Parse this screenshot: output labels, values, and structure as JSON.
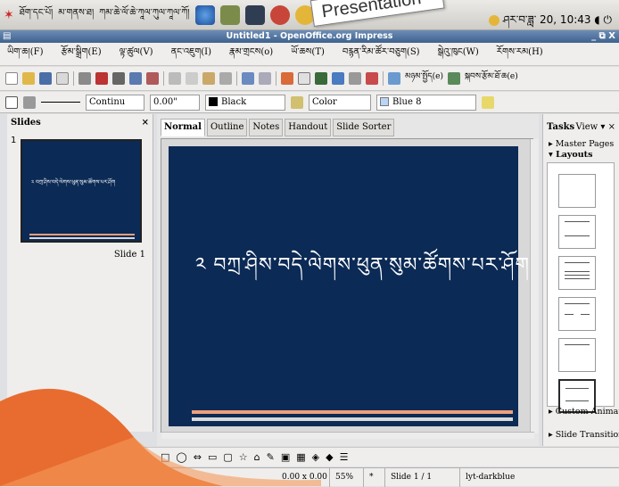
{
  "topbar": {
    "menus": [
      "ཐོག་དང་པོ།",
      "མ་གནས་ཐ།",
      "ཀམ་ཆེ་ལོ་ཆེ་ཀཱལ་ཀུལ་ཀཱལ་ཀོ།",
      "ཀམ་ཆེ་ལོ།"
    ],
    "clock": "ཤར་བ་ཟླ་ 20, 10:43",
    "callout": "Presentation"
  },
  "window": {
    "title": "Untitled1 - OpenOffice.org Impress",
    "controls": "_ ⧉ X"
  },
  "menu": [
    "ཡིག་ཆ།(F)",
    "རྩོམ་སྒྲིག(E)",
    "ལྟ་ཚུལ(V)",
    "ནང་འཇུག(I)",
    "རྣམ་གྲངས(o)",
    "ཡོ་ཆས(T)",
    "བརྙན་རིམ་ཚོར་བཅུག(S)",
    "སྒེའུ་ཁུང(W)",
    "རོགས་རམ(H)"
  ],
  "toolbar1": {
    "labels": [
      "མཉམ་སྤྱོད(e)",
      "སྐབས་རྩོམ་ཐོ་ཆ(e)"
    ]
  },
  "toolbar2": {
    "line_style": "Continu",
    "line_width": "0.00\"",
    "line_color": "Black",
    "area_style": "Color",
    "area_color": "Blue 8"
  },
  "slides_panel": {
    "title": "Slides",
    "slide_number": "1",
    "slide_label": "Slide 1",
    "thumb_text": "༢ བཀྲ་ཤིས་བདེ་ལེགས་ཕུན་སུམ་ཚོགས་པར་ཤོག"
  },
  "tabs": [
    "Normal",
    "Outline",
    "Notes",
    "Handout",
    "Slide Sorter"
  ],
  "slide": {
    "text": "༢ བཀྲ་ཤིས་བདེ་ལེགས་ཕུན་སུམ་ཚོགས་པར་ཤོག",
    "background": "#0b2a55",
    "line_colors": [
      "#f0a07a",
      "#d9d9d9"
    ]
  },
  "tasks": {
    "title": "Tasks",
    "view": "View",
    "sections": [
      "Master Pages",
      "Layouts",
      "Custom Animation",
      "Slide Transition"
    ]
  },
  "status": {
    "size": "0.00 x 0.00",
    "zoom": "55%",
    "modified": "*",
    "slide": "Slide 1 / 1",
    "layout": "lyt-darkblue"
  },
  "colors": {
    "accent_orange": "#e86c2f",
    "titlebar": "#4a6f9a"
  }
}
